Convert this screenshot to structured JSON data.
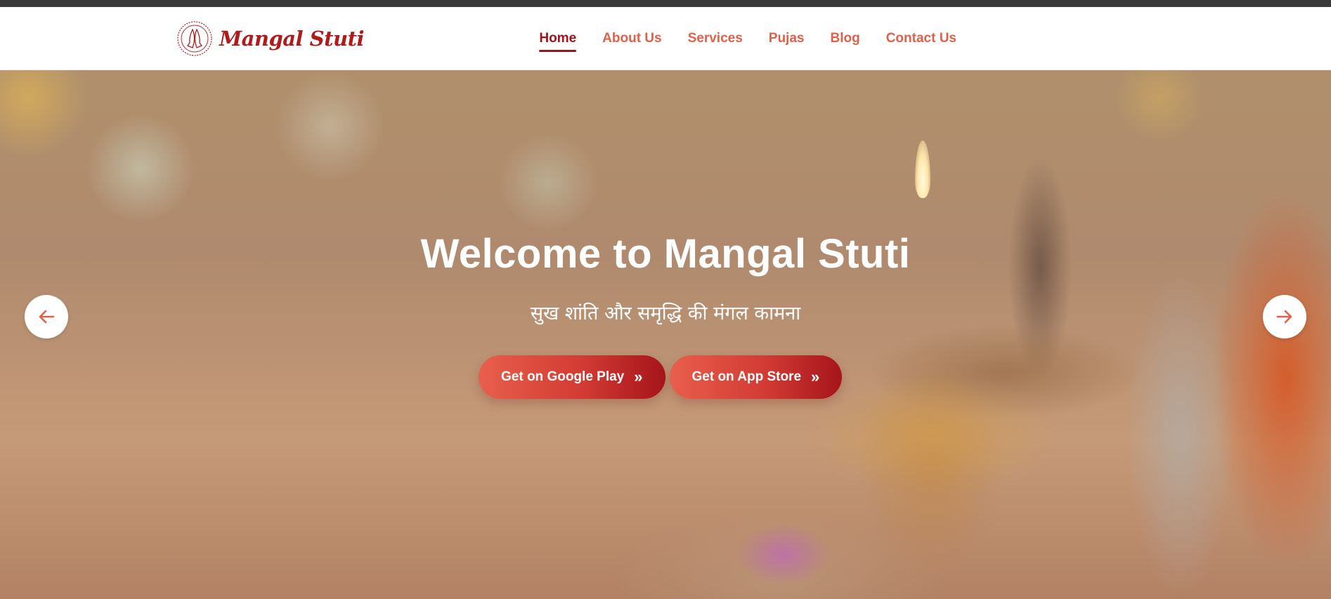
{
  "brand": {
    "name": "Mangal Stuti"
  },
  "nav": {
    "items": [
      {
        "label": "Home",
        "active": true
      },
      {
        "label": "About Us",
        "active": false
      },
      {
        "label": "Services",
        "active": false
      },
      {
        "label": "Pujas",
        "active": false
      },
      {
        "label": "Blog",
        "active": false
      },
      {
        "label": "Contact Us",
        "active": false
      }
    ]
  },
  "hero": {
    "title": "Welcome to Mangal Stuti",
    "subtitle": "सुख शांति और समृद्धि की मंगल कामना",
    "buttons": [
      {
        "label": "Get on Google Play",
        "icon": "double-chevron-right-icon"
      },
      {
        "label": "Get on App Store",
        "icon": "double-chevron-right-icon"
      }
    ],
    "prev_icon": "arrow-left-icon",
    "next_icon": "arrow-right-icon"
  },
  "colors": {
    "accent": "#e06049",
    "accent_dark": "#a3121a",
    "topbar": "#3a3a3a"
  }
}
